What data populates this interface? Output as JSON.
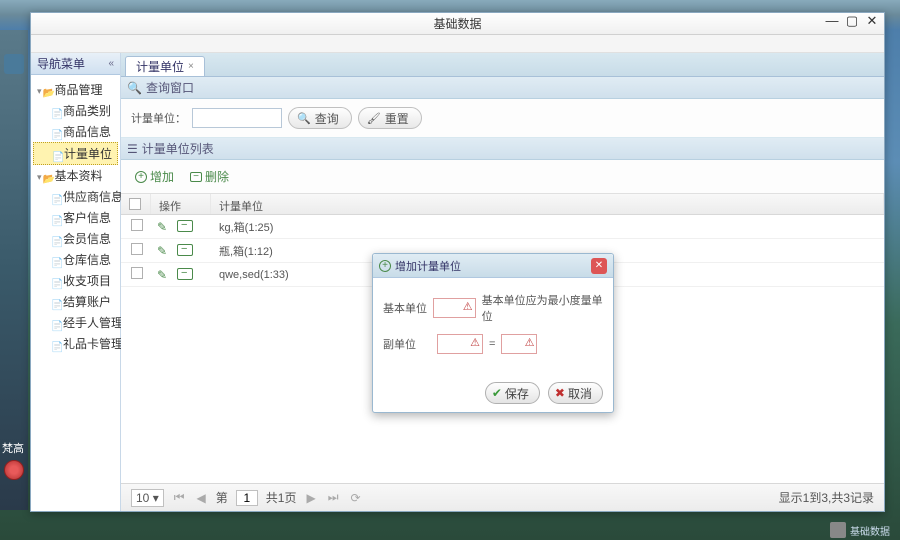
{
  "window": {
    "title": "基础数据"
  },
  "nav": {
    "title": "导航菜单",
    "groups": [
      {
        "label": "商品管理",
        "items": [
          {
            "label": "商品类别"
          },
          {
            "label": "商品信息"
          },
          {
            "label": "计量单位",
            "selected": true
          }
        ]
      },
      {
        "label": "基本资料",
        "items": [
          {
            "label": "供应商信息"
          },
          {
            "label": "客户信息"
          },
          {
            "label": "会员信息"
          },
          {
            "label": "仓库信息"
          },
          {
            "label": "收支项目"
          },
          {
            "label": "结算账户"
          },
          {
            "label": "经手人管理"
          },
          {
            "label": "礼品卡管理"
          }
        ]
      }
    ]
  },
  "tab": {
    "label": "计量单位"
  },
  "search_panel": {
    "title": "查询窗口",
    "field_label": "计量单位：",
    "query_btn": "查询",
    "reset_btn": "重置"
  },
  "list_panel": {
    "title": "计量单位列表",
    "add_btn": "增加",
    "del_btn": "删除",
    "columns": {
      "op": "操作",
      "name": "计量单位"
    },
    "rows": [
      {
        "name": "kg,箱(1:25)"
      },
      {
        "name": "瓶,箱(1:12)"
      },
      {
        "name": "qwe,sed(1:33)"
      }
    ]
  },
  "pager": {
    "size": "10",
    "page_label_prefix": "第",
    "page_value": "1",
    "total_pages": "共1页",
    "info": "显示1到3,共3记录"
  },
  "dialog": {
    "title": "增加计量单位",
    "base_label": "基本单位",
    "base_hint": "基本单位应为最小度量单位",
    "alt_label": "副单位",
    "eq": "=",
    "save_btn": "保存",
    "cancel_btn": "取消"
  },
  "side": {
    "fg": "梵高"
  },
  "tray": {
    "label": "基础数据"
  }
}
